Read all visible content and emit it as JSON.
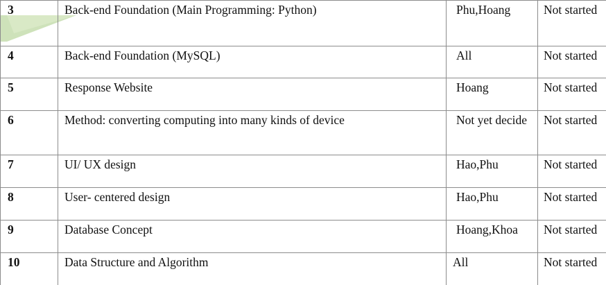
{
  "rows": [
    {
      "no": "3",
      "task": "Back-end Foundation (Main Programming: Python)",
      "who": "Phu,Hoang",
      "status": "Not started"
    },
    {
      "no": "4",
      "task": "Back-end Foundation (MySQL)",
      "who": "All",
      "status": "Not started"
    },
    {
      "no": "5",
      "task": "Response Website",
      "who": "Hoang",
      "status": "Not started"
    },
    {
      "no": "6",
      "task": "Method: converting computing into many kinds of device",
      "who": "Not yet decide",
      "status": "Not started"
    },
    {
      "no": "7",
      "task": "UI/ UX design",
      "who": "Hao,Phu",
      "status": "Not started"
    },
    {
      "no": "8",
      "task": "User- centered design",
      "who": "Hao,Phu",
      "status": "Not started"
    },
    {
      "no": "9",
      "task": "Database Concept",
      "who": "Hoang,Khoa",
      "status": "Not started"
    },
    {
      "no": "10",
      "task": "Data Structure and Algorithm",
      "who": "All",
      "status": "Not started"
    }
  ],
  "colors": {
    "border": "#8c8c8c",
    "corner_shape": "#c9dfb2"
  }
}
